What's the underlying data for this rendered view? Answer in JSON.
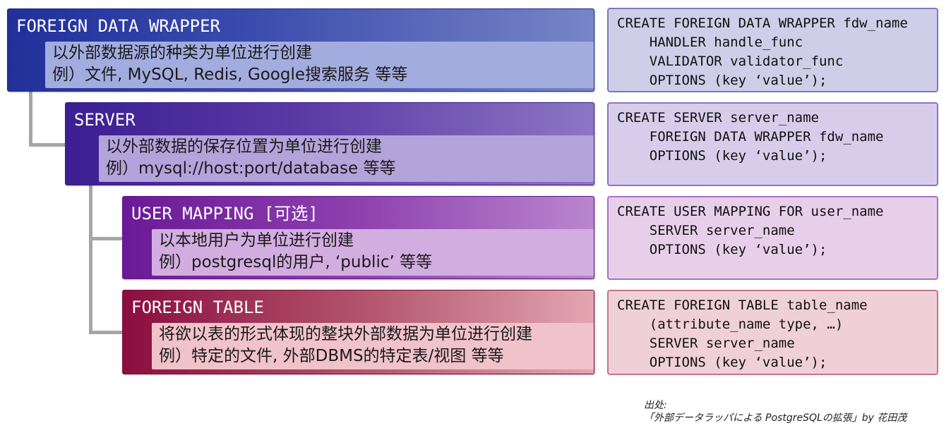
{
  "levels": [
    {
      "title": "FOREIGN DATA WRAPPER",
      "desc_line1": "以外部数据源的种类为单位进行创建",
      "desc_line2": "例）文件, MySQL, Redis, Google搜索服务 等等",
      "code": "CREATE FOREIGN DATA WRAPPER fdw_name\n    HANDLER handle_func\n    VALIDATOR validator_func\n    OPTIONS (key ‘value’);"
    },
    {
      "title": "SERVER",
      "desc_line1": "以外部数据的保存位置为单位进行创建",
      "desc_line2": "例）mysql://host:port/database 等等",
      "code": "CREATE SERVER server_name\n    FOREIGN DATA WRAPPER fdw_name\n    OPTIONS (key ‘value’);"
    },
    {
      "title": "USER MAPPING [可选]",
      "desc_line1": "以本地用户为单位进行创建",
      "desc_line2": "例）postgresql的用户, ‘public’ 等等",
      "code": "CREATE USER MAPPING FOR user_name\n    SERVER server_name\n    OPTIONS (key ‘value’);"
    },
    {
      "title": "FOREIGN TABLE",
      "desc_line1": "将欲以表的形式体现的整块外部数据为单位进行创建",
      "desc_line2": "例）特定的文件, 外部DBMS的特定表/视图 等等",
      "code": "CREATE FOREIGN TABLE table_name\n    (attribute_name type, …)\n    SERVER server_name\n    OPTIONS (key ‘value’);"
    }
  ],
  "source": {
    "label": "出处:",
    "citation": "「外部データラッパによる PostgreSQLの拡張」by 花田茂"
  }
}
